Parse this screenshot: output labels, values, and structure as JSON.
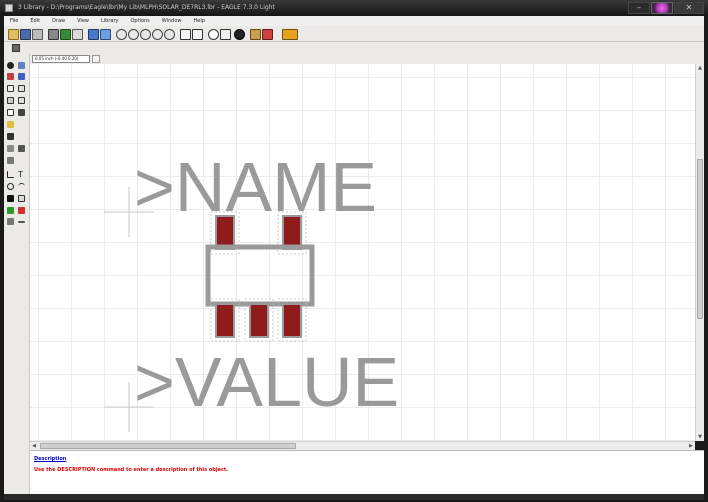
{
  "window": {
    "title": "3 Library - D:\\Programs\\Eagle\\lbr\\My Lib\\MLPH\\SOLAR_DE7RL3.lbr - EAGLE 7.3.0 Light",
    "controls": [
      "minimize",
      "maximize",
      "close"
    ]
  },
  "menu": [
    "File",
    "Edit",
    "Draw",
    "View",
    "Library",
    "Options",
    "Window",
    "Help"
  ],
  "coords": {
    "readout": "0.05 inch (-0.40 0.20)"
  },
  "package": {
    "name_text": ">NAME",
    "value_text": ">VALUE"
  },
  "description": {
    "link_label": "Description",
    "hint": "Use the DESCRIPTION command to enter a description of this object."
  },
  "colors": {
    "pad": "#8e1c1c",
    "outline": "#9a9a9a",
    "grid": "#ececec",
    "hint": "#e00000"
  },
  "icons": {
    "toolbar": [
      "open-icon",
      "save-icon",
      "print-icon",
      "cam-icon",
      "board-icon",
      "schematic-icon",
      "script-icon",
      "run-icon",
      "zoom-fit-icon",
      "zoom-in-icon",
      "zoom-out-icon",
      "zoom-redraw-icon",
      "zoom-select-icon",
      "undo-icon",
      "redo-icon",
      "stop-icon",
      "go-icon",
      "help-icon",
      "library-icon",
      "package-icon",
      "device-icon"
    ],
    "sidebar": [
      "info-icon",
      "show-icon",
      "display-icon",
      "mark-icon",
      "move-icon",
      "copy-icon",
      "mirror-icon",
      "rotate-icon",
      "group-icon",
      "change-icon",
      "paste-icon",
      "delete-icon",
      "add-icon",
      "pinswap-icon",
      "replace-icon",
      "name-icon",
      "value-icon",
      "smash-icon",
      "miter-icon",
      "split-icon",
      "wire-icon",
      "text-icon",
      "circle-icon",
      "arc-icon",
      "rect-icon",
      "polygon-icon",
      "via-icon",
      "hole-icon",
      "attribute-icon",
      "dimension-icon"
    ]
  }
}
